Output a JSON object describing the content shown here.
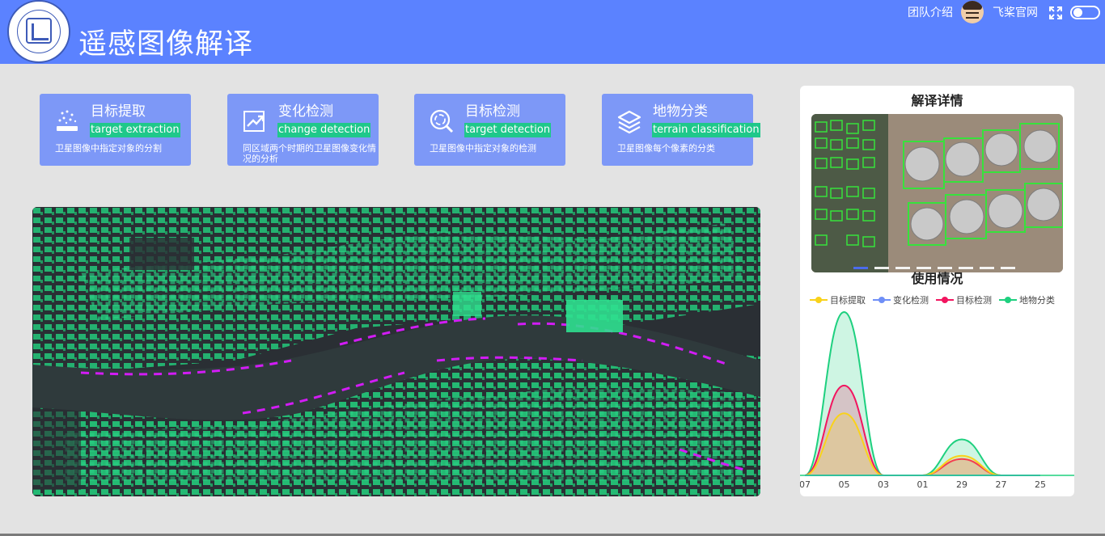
{
  "header": {
    "title": "遥感图像解译",
    "links": {
      "team": "团队介绍",
      "paddle": "飞桨官网"
    }
  },
  "cards": [
    {
      "title": "目标提取",
      "tag": "target extraction",
      "desc": "卫星图像中指定对象的分割",
      "icon": "sparkle-layer-icon"
    },
    {
      "title": "变化检测",
      "tag": "change detection",
      "desc": "同区域两个时期的卫星图像变化情况的分析",
      "icon": "trend-chart-icon"
    },
    {
      "title": "目标检测",
      "tag": "target detection",
      "desc": "卫星图像中指定对象的检测",
      "icon": "search-scan-icon"
    },
    {
      "title": "地物分类",
      "tag": "terrain classification",
      "desc": "卫星图像每个像素的分类",
      "icon": "layers-icon"
    }
  ],
  "side": {
    "detail_title": "解译详情",
    "usage_title": "使用情况"
  },
  "colors": {
    "header": "#5b82ff",
    "card": "#7d98f7",
    "tag": "#1fc88a",
    "extract": "#f9d21a",
    "change": "#6f8ff7",
    "detect": "#f2155f",
    "classify": "#1ed07f"
  },
  "chart_data": {
    "type": "area",
    "categories": [
      "07",
      "05",
      "03",
      "01",
      "29",
      "27",
      "25"
    ],
    "series": [
      {
        "name": "目标提取",
        "values": [
          0,
          38,
          0,
          0,
          12,
          0,
          0
        ]
      },
      {
        "name": "变化检测",
        "values": [
          0,
          0,
          0,
          0,
          0,
          0,
          0
        ]
      },
      {
        "name": "目标检测",
        "values": [
          0,
          55,
          0,
          0,
          10,
          0,
          0
        ]
      },
      {
        "name": "地物分类",
        "values": [
          0,
          100,
          0,
          0,
          22,
          0,
          0
        ]
      }
    ],
    "legend": "top"
  }
}
